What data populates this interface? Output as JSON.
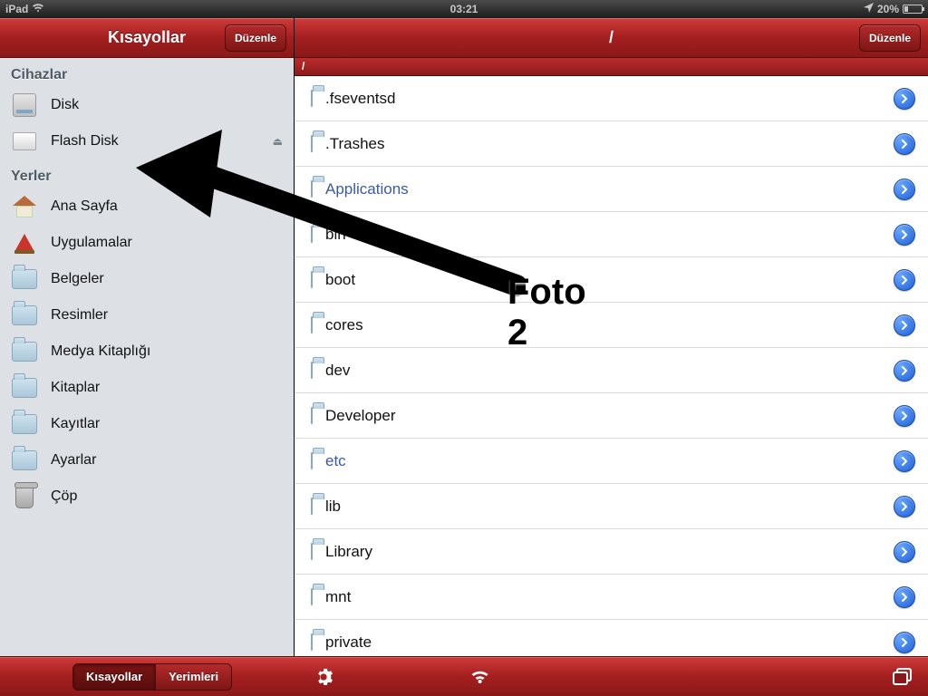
{
  "statusbar": {
    "device": "iPad",
    "time": "03:21",
    "battery": "20%"
  },
  "sidebar": {
    "title": "Kısayollar",
    "edit": "Düzenle",
    "sections": {
      "devices": "Cihazlar",
      "places": "Yerler"
    },
    "devices": [
      {
        "label": "Disk",
        "icon": "hd"
      },
      {
        "label": "Flash Disk",
        "icon": "flash",
        "eject": true
      }
    ],
    "places": [
      {
        "label": "Ana Sayfa",
        "icon": "home"
      },
      {
        "label": "Uygulamalar",
        "icon": "apps"
      },
      {
        "label": "Belgeler",
        "icon": "folder"
      },
      {
        "label": "Resimler",
        "icon": "folder"
      },
      {
        "label": "Medya Kitaplığı",
        "icon": "folder"
      },
      {
        "label": "Kitaplar",
        "icon": "folder"
      },
      {
        "label": "Kayıtlar",
        "icon": "folder"
      },
      {
        "label": "Ayarlar",
        "icon": "folder"
      },
      {
        "label": "Çöp",
        "icon": "trash"
      }
    ]
  },
  "main": {
    "title": "/",
    "edit": "Düzenle",
    "path": "/",
    "rows": [
      {
        "name": ".fseventsd",
        "link": false
      },
      {
        "name": ".Trashes",
        "link": false
      },
      {
        "name": "Applications",
        "link": true
      },
      {
        "name": "bin",
        "link": false
      },
      {
        "name": "boot",
        "link": false
      },
      {
        "name": "cores",
        "link": false
      },
      {
        "name": "dev",
        "link": false
      },
      {
        "name": "Developer",
        "link": false
      },
      {
        "name": "etc",
        "link": true
      },
      {
        "name": "lib",
        "link": false
      },
      {
        "name": "Library",
        "link": false
      },
      {
        "name": "mnt",
        "link": false
      },
      {
        "name": "private",
        "link": false
      }
    ]
  },
  "toolbar": {
    "tab1": "Kısayollar",
    "tab2": "Yerimleri"
  },
  "annotation": {
    "label": "Foto 2"
  }
}
